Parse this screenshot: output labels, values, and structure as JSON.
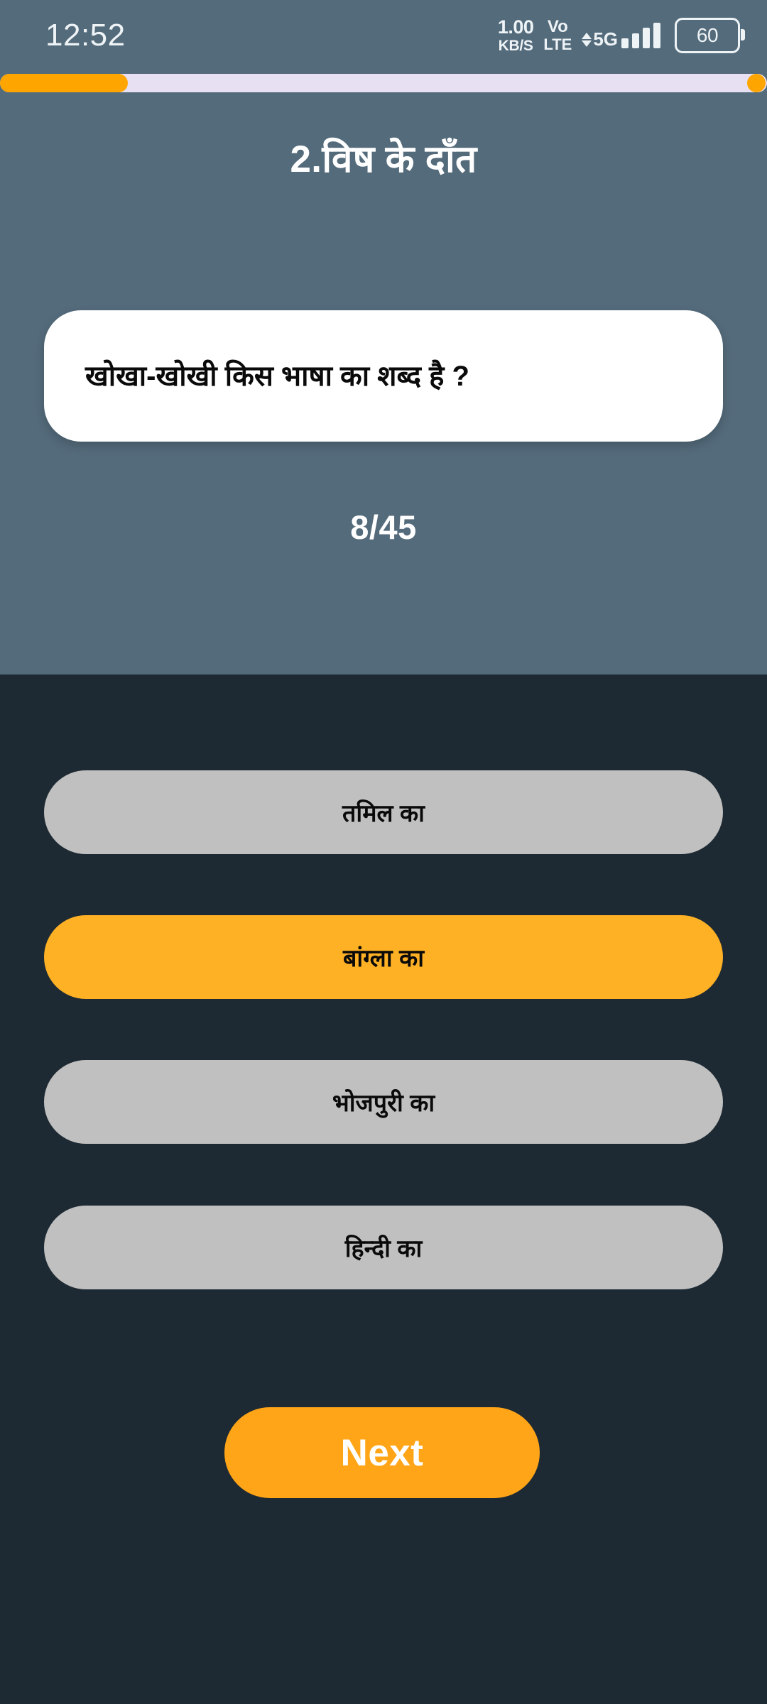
{
  "status_bar": {
    "clock": "12:52",
    "network_speed_value": "1.00",
    "network_speed_unit": "KB/S",
    "volte_top": "Vo",
    "volte_bottom": "LTE",
    "network_type": "5G",
    "battery_level": "60"
  },
  "progress": {
    "percent": 16.7,
    "accent_color": "#ffa500",
    "track_color": "#e7e0f2"
  },
  "header": {
    "chapter_title": "2.विष के दाँत",
    "background_color": "#546b7b"
  },
  "question": {
    "text": "खोखा-खोखी किस भाषा का शब्द है ?",
    "counter": "8/45",
    "card_background": "#ffffff"
  },
  "options": {
    "background_color": "#1e2a33",
    "default_color": "#c0c0c0",
    "selected_color": "#ffb125",
    "items": [
      {
        "label": "तमिल का",
        "selected": false
      },
      {
        "label": "बांग्ला का",
        "selected": true
      },
      {
        "label": "भोजपुरी का",
        "selected": false
      },
      {
        "label": "हिन्दी का",
        "selected": false
      }
    ]
  },
  "footer": {
    "next_label": "Next",
    "next_color": "#ffa517"
  }
}
